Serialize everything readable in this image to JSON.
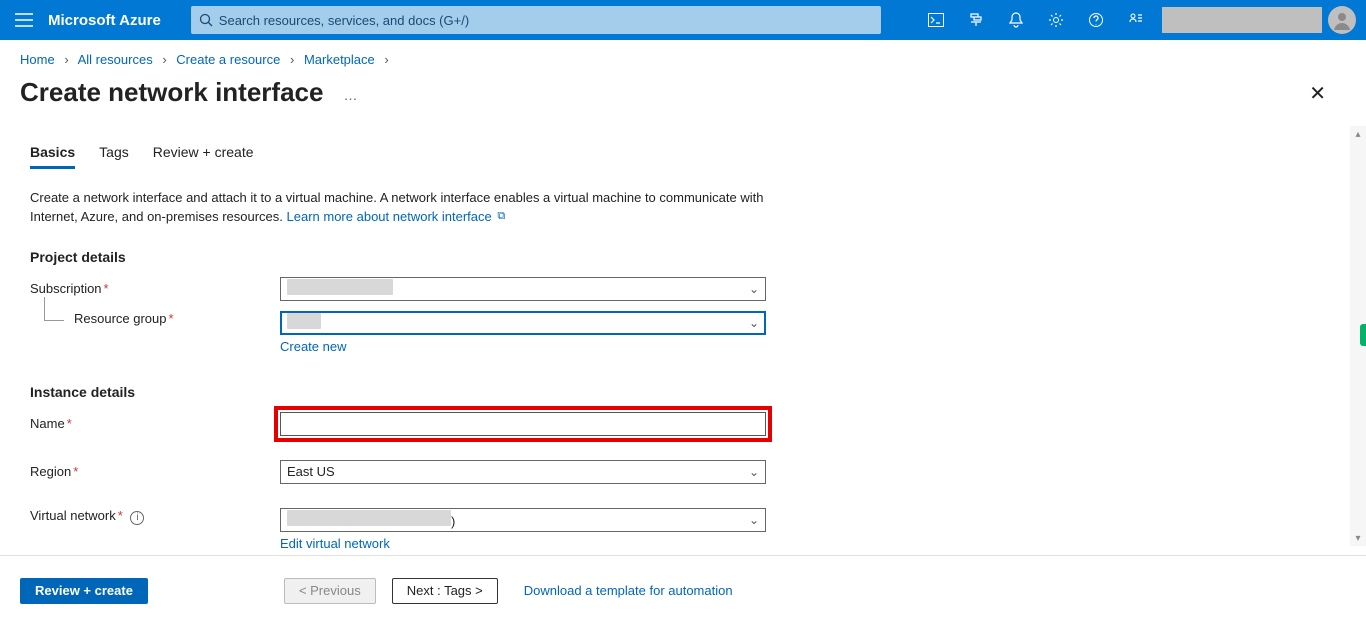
{
  "topbar": {
    "brand": "Microsoft Azure",
    "search_placeholder": "Search resources, services, and docs (G+/)"
  },
  "breadcrumb": {
    "items": [
      "Home",
      "All resources",
      "Create a resource",
      "Marketplace"
    ]
  },
  "page": {
    "title": "Create network interface"
  },
  "tabs": {
    "items": [
      {
        "label": "Basics",
        "active": true
      },
      {
        "label": "Tags",
        "active": false
      },
      {
        "label": "Review + create",
        "active": false
      }
    ]
  },
  "intro": {
    "text": "Create a network interface and attach it to a virtual machine. A network interface enables a virtual machine to communicate with Internet, Azure, and on-premises resources. ",
    "link_label": "Learn more about network interface"
  },
  "sections": {
    "project_details": "Project details",
    "instance_details": "Instance details"
  },
  "fields": {
    "subscription": {
      "label": "Subscription",
      "value": ""
    },
    "resource_group": {
      "label": "Resource group",
      "value": "",
      "create_new": "Create new"
    },
    "name": {
      "label": "Name",
      "value": ""
    },
    "region": {
      "label": "Region",
      "value": "East US"
    },
    "vnet": {
      "label": "Virtual network",
      "value_suffix": ")",
      "edit_label": "Edit virtual network"
    }
  },
  "footer": {
    "review": "Review + create",
    "previous": "< Previous",
    "next": "Next : Tags >",
    "download": "Download a template for automation"
  }
}
